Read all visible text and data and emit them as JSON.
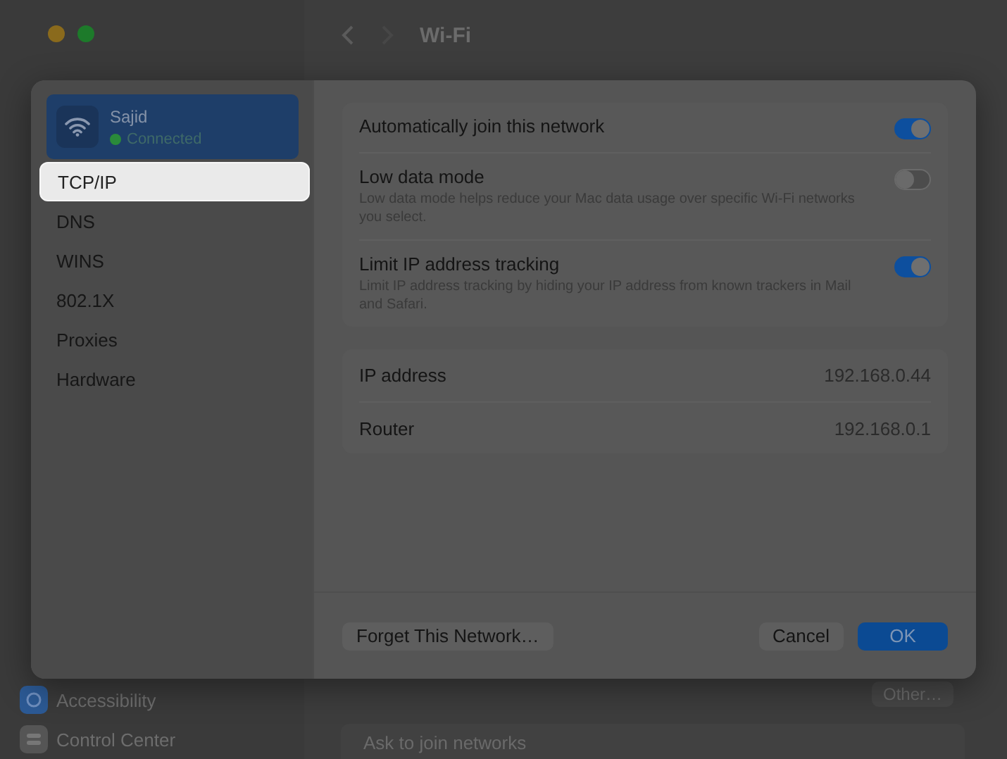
{
  "window": {
    "title": "Wi-Fi"
  },
  "background_sidebar": {
    "items": [
      {
        "label": "Accessibility",
        "kind": "accessibility"
      },
      {
        "label": "Control Center",
        "kind": "control"
      }
    ]
  },
  "background_content": {
    "other_button": "Other…",
    "ask_to_join": "Ask to join networks"
  },
  "sheet": {
    "network": {
      "name": "Sajid",
      "status": "Connected",
      "selected": true
    },
    "nav": [
      {
        "label": "TCP/IP",
        "selected": true
      },
      {
        "label": "DNS",
        "selected": false
      },
      {
        "label": "WINS",
        "selected": false
      },
      {
        "label": "802.1X",
        "selected": false
      },
      {
        "label": "Proxies",
        "selected": false
      },
      {
        "label": "Hardware",
        "selected": false
      }
    ],
    "toggles": [
      {
        "label": "Automatically join this network",
        "on": true
      },
      {
        "label": "Low data mode",
        "description": "Low data mode helps reduce your Mac data usage over specific Wi-Fi networks you select.",
        "on": false
      },
      {
        "label": "Limit IP address tracking",
        "description": "Limit IP address tracking by hiding your IP address from known trackers in Mail and Safari.",
        "on": true
      }
    ],
    "info": [
      {
        "label": "IP address",
        "value": "192.168.0.44"
      },
      {
        "label": "Router",
        "value": "192.168.0.1"
      }
    ],
    "buttons": {
      "forget": "Forget This Network…",
      "cancel": "Cancel",
      "ok": "OK"
    }
  }
}
